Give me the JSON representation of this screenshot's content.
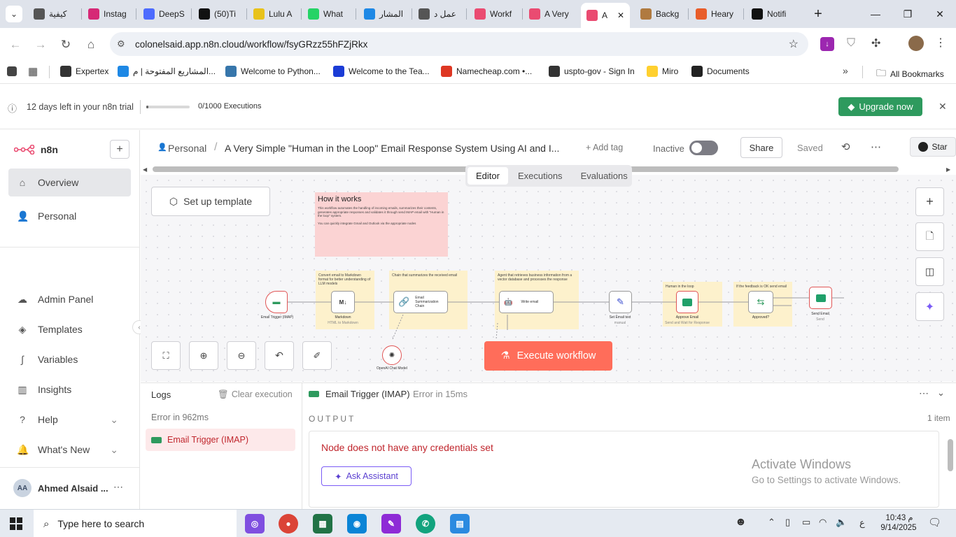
{
  "browser": {
    "tabs": [
      {
        "label": "كيفية",
        "icon": "chrome-icon",
        "color": "#555"
      },
      {
        "label": "Instag",
        "icon": "instagram-icon",
        "color": "#d62976"
      },
      {
        "label": "DeepS",
        "icon": "deepseek-icon",
        "color": "#4d6bfe"
      },
      {
        "label": "(50)Ti",
        "icon": "tiktok-icon",
        "color": "#111"
      },
      {
        "label": "Lulu A",
        "icon": "lulu-icon",
        "color": "#e8c21b"
      },
      {
        "label": "What",
        "icon": "whatsapp-icon",
        "color": "#25d366"
      },
      {
        "label": "المشار",
        "icon": "circle-icon",
        "color": "#1e88e5"
      },
      {
        "label": "عمل د",
        "icon": "chrome-icon",
        "color": "#555"
      },
      {
        "label": "Workf",
        "icon": "n8n-icon",
        "color": "#ea4b71"
      },
      {
        "label": "A Very",
        "icon": "n8n-icon",
        "color": "#ea4b71"
      },
      {
        "label": "A",
        "icon": "n8n-icon",
        "color": "#ea4b71"
      },
      {
        "label": "Backg",
        "icon": "ai-icon",
        "color": "#b07a40"
      },
      {
        "label": "Heary",
        "icon": "mail-icon",
        "color": "#e85d2a"
      },
      {
        "label": "Notifi",
        "icon": "x-icon",
        "color": "#111"
      }
    ],
    "url": "colonelsaid.app.n8n.cloud/workflow/fsyGRzz55hFZjRkx",
    "bookmarks": [
      {
        "label": "Expertex",
        "color": "#333"
      },
      {
        "label": "المشاريع المفتوحة | م...",
        "color": "#1e88e5"
      },
      {
        "label": "Welcome to Python...",
        "color": "#3776ab"
      },
      {
        "label": "Welcome to the Tea...",
        "color": "#1b3cd6"
      },
      {
        "label": "Namecheap.com •...",
        "color": "#de3723"
      },
      {
        "label": "uspto-gov - Sign In",
        "color": "#333"
      },
      {
        "label": "Miro",
        "color": "#ffd02f"
      },
      {
        "label": "Documents",
        "color": "#222"
      }
    ],
    "all_bookmarks": "All Bookmarks"
  },
  "trial": {
    "days_left": "12 days left in your n8n trial",
    "executions": "0/1000 Executions",
    "progress": 0.02,
    "upgrade_label": "Upgrade now"
  },
  "sidebar": {
    "brand": "n8n",
    "items": [
      {
        "label": "Overview",
        "icon": "home-icon",
        "glyph": "⌂"
      },
      {
        "label": "Personal",
        "icon": "user-icon",
        "glyph": "👤"
      }
    ],
    "bottom_items": [
      {
        "label": "Admin Panel",
        "icon": "cloud-icon",
        "glyph": "☁"
      },
      {
        "label": "Templates",
        "icon": "layers-icon",
        "glyph": "◈"
      },
      {
        "label": "Variables",
        "icon": "variables-icon",
        "glyph": "∫"
      },
      {
        "label": "Insights",
        "icon": "chart-icon",
        "glyph": "▥"
      },
      {
        "label": "Help",
        "icon": "help-icon",
        "glyph": "?"
      },
      {
        "label": "What's New",
        "icon": "bell-icon",
        "glyph": "🔔"
      }
    ],
    "user": {
      "initials": "AA",
      "name": "Ahmed Alsaid ..."
    }
  },
  "header": {
    "project": "Personal",
    "title": "A Very Simple \"Human in the Loop\" Email Response System Using AI and I...",
    "add_tag": "+ Add tag",
    "status": "Inactive",
    "share": "Share",
    "saved": "Saved",
    "github_star": "Star",
    "tabs": [
      "Editor",
      "Executions",
      "Evaluations"
    ]
  },
  "canvas": {
    "setup_template": "Set up template",
    "how_it_works_title": "How it works",
    "how_it_works_text": "This workflow automates the handling of incoming emails, summarizes their contents, generates appropriate responses and validates it through send IMAP email with \"Human in the loop\" system.",
    "how_it_works_text2": "You can quickly integrate Gmail and Outlook via the appropriate nodes",
    "notes": [
      "Convert email to Markdown format for better understanding of LLM models",
      "Chain that summarizes the received email",
      "Agent that retrieves business information from a vector database and processes the response",
      "Human in the loop",
      "If the feedback is OK send email"
    ],
    "nodes": [
      {
        "label": "Email Trigger (IMAP)",
        "sub": ""
      },
      {
        "label": "Markdown",
        "sub": "HTML to Markdown"
      },
      {
        "label": "Email Summarization Chain",
        "sub": ""
      },
      {
        "label": "Write email",
        "sub": ""
      },
      {
        "label": "Set Email text",
        "sub": "manual"
      },
      {
        "label": "Approve Email",
        "sub": "Send and Wait for Response"
      },
      {
        "label": "Approved?",
        "sub": ""
      },
      {
        "label": "Send Email",
        "sub": "Send"
      },
      {
        "label": "OpenAI Chat Model",
        "sub": ""
      }
    ],
    "execute_label": "Execute workflow"
  },
  "logs": {
    "title": "Logs",
    "clear": "Clear execution",
    "error_time": "Error in 962ms",
    "run_item": "Email Trigger (IMAP)",
    "node_name": "Email Trigger (IMAP)",
    "node_status": "Error in 15ms",
    "output_label": "OUTPUT",
    "items": "1 item",
    "error_message": "Node does not have any credentials set",
    "ask_assistant": "Ask Assistant",
    "activate_title": "Activate Windows",
    "activate_sub": "Go to Settings to activate Windows."
  },
  "taskbar": {
    "search_placeholder": "Type here to search",
    "time": "10:43 م",
    "date": "9/14/2025",
    "lang": "ع"
  },
  "colors": {
    "n8n_accent": "#ea4b71",
    "execute": "#ff6d5a",
    "upgrade": "#2e9a5e",
    "error_text": "#c0262d"
  }
}
